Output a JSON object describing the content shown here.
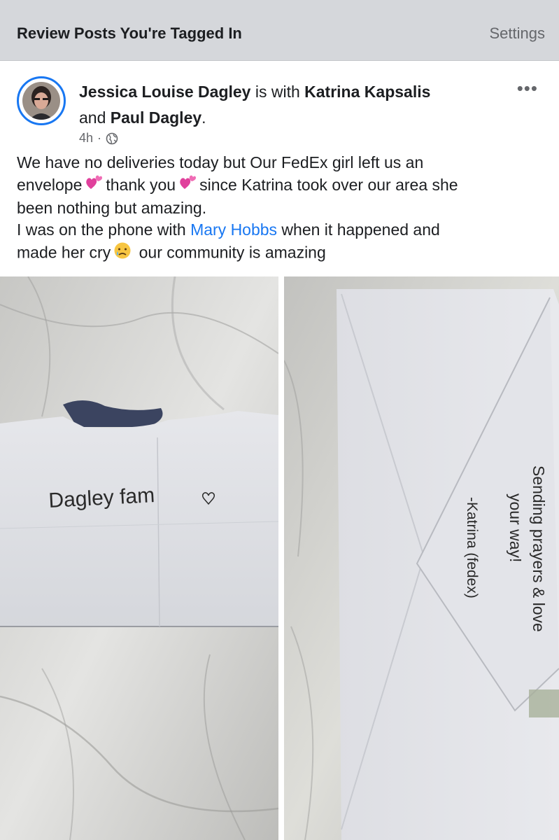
{
  "topbar": {
    "title": "Review Posts You're Tagged In",
    "settings_label": "Settings"
  },
  "post": {
    "author": "Jessica Louise Dagley",
    "with_text": " is with ",
    "tag1": "Katrina Kapsalis",
    "and_text": "and ",
    "tag2": "Paul Dagley",
    "period": ".",
    "time": "4h",
    "privacy_icon": "globe-icon",
    "more_icon": "more-options-icon",
    "body": {
      "line1": "We have no deliveries today but Our FedEx girl left us an",
      "seg_envelope": "envelope",
      "seg_thank_you": "thank you",
      "seg_since": "since Katrina took over our area she",
      "line3": "been nothing but amazing.",
      "seg_was_on_phone": "I was on the phone with ",
      "mention": "Mary Hobbs",
      "seg_when": " when it happened and",
      "seg_made_her_cry": "made her cry",
      "seg_community": "our community is amazing"
    },
    "photos": {
      "left_handwriting": "Dagley fam",
      "right_handwriting_line1": "Sending prayers & love",
      "right_handwriting_line2": "your way!",
      "right_handwriting_line3": "-Katrina (fedex)"
    }
  }
}
